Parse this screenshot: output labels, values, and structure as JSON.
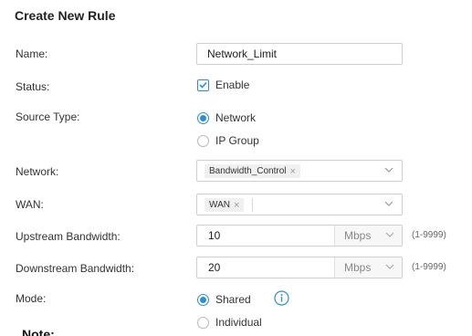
{
  "title": "Create New Rule",
  "labels": {
    "name": "Name:",
    "status": "Status:",
    "source_type": "Source Type:",
    "network": "Network:",
    "wan": "WAN:",
    "upstream": "Upstream Bandwidth:",
    "downstream": "Downstream Bandwidth:",
    "mode": "Mode:"
  },
  "name_field": {
    "value": "Network_Limit"
  },
  "status": {
    "option": "Enable",
    "checked": true
  },
  "source_type": {
    "options": [
      {
        "label": "Network",
        "selected": true
      },
      {
        "label": "IP Group",
        "selected": false
      }
    ]
  },
  "network_select": {
    "tag": "Bandwidth_Control",
    "remove_glyph": "×"
  },
  "wan_select": {
    "tag": "WAN",
    "remove_glyph": "×"
  },
  "upstream": {
    "value": "10",
    "unit": "Mbps",
    "range": "(1-9999)"
  },
  "downstream": {
    "value": "20",
    "unit": "Mbps",
    "range": "(1-9999)"
  },
  "mode": {
    "options": [
      {
        "label": "Shared",
        "selected": true
      },
      {
        "label": "Individual",
        "selected": false
      }
    ],
    "info_icon": "info-icon"
  },
  "note": "Note:",
  "colors": {
    "accent": "#2a8fd6",
    "border": "#cfcfcf",
    "text": "#333333"
  }
}
